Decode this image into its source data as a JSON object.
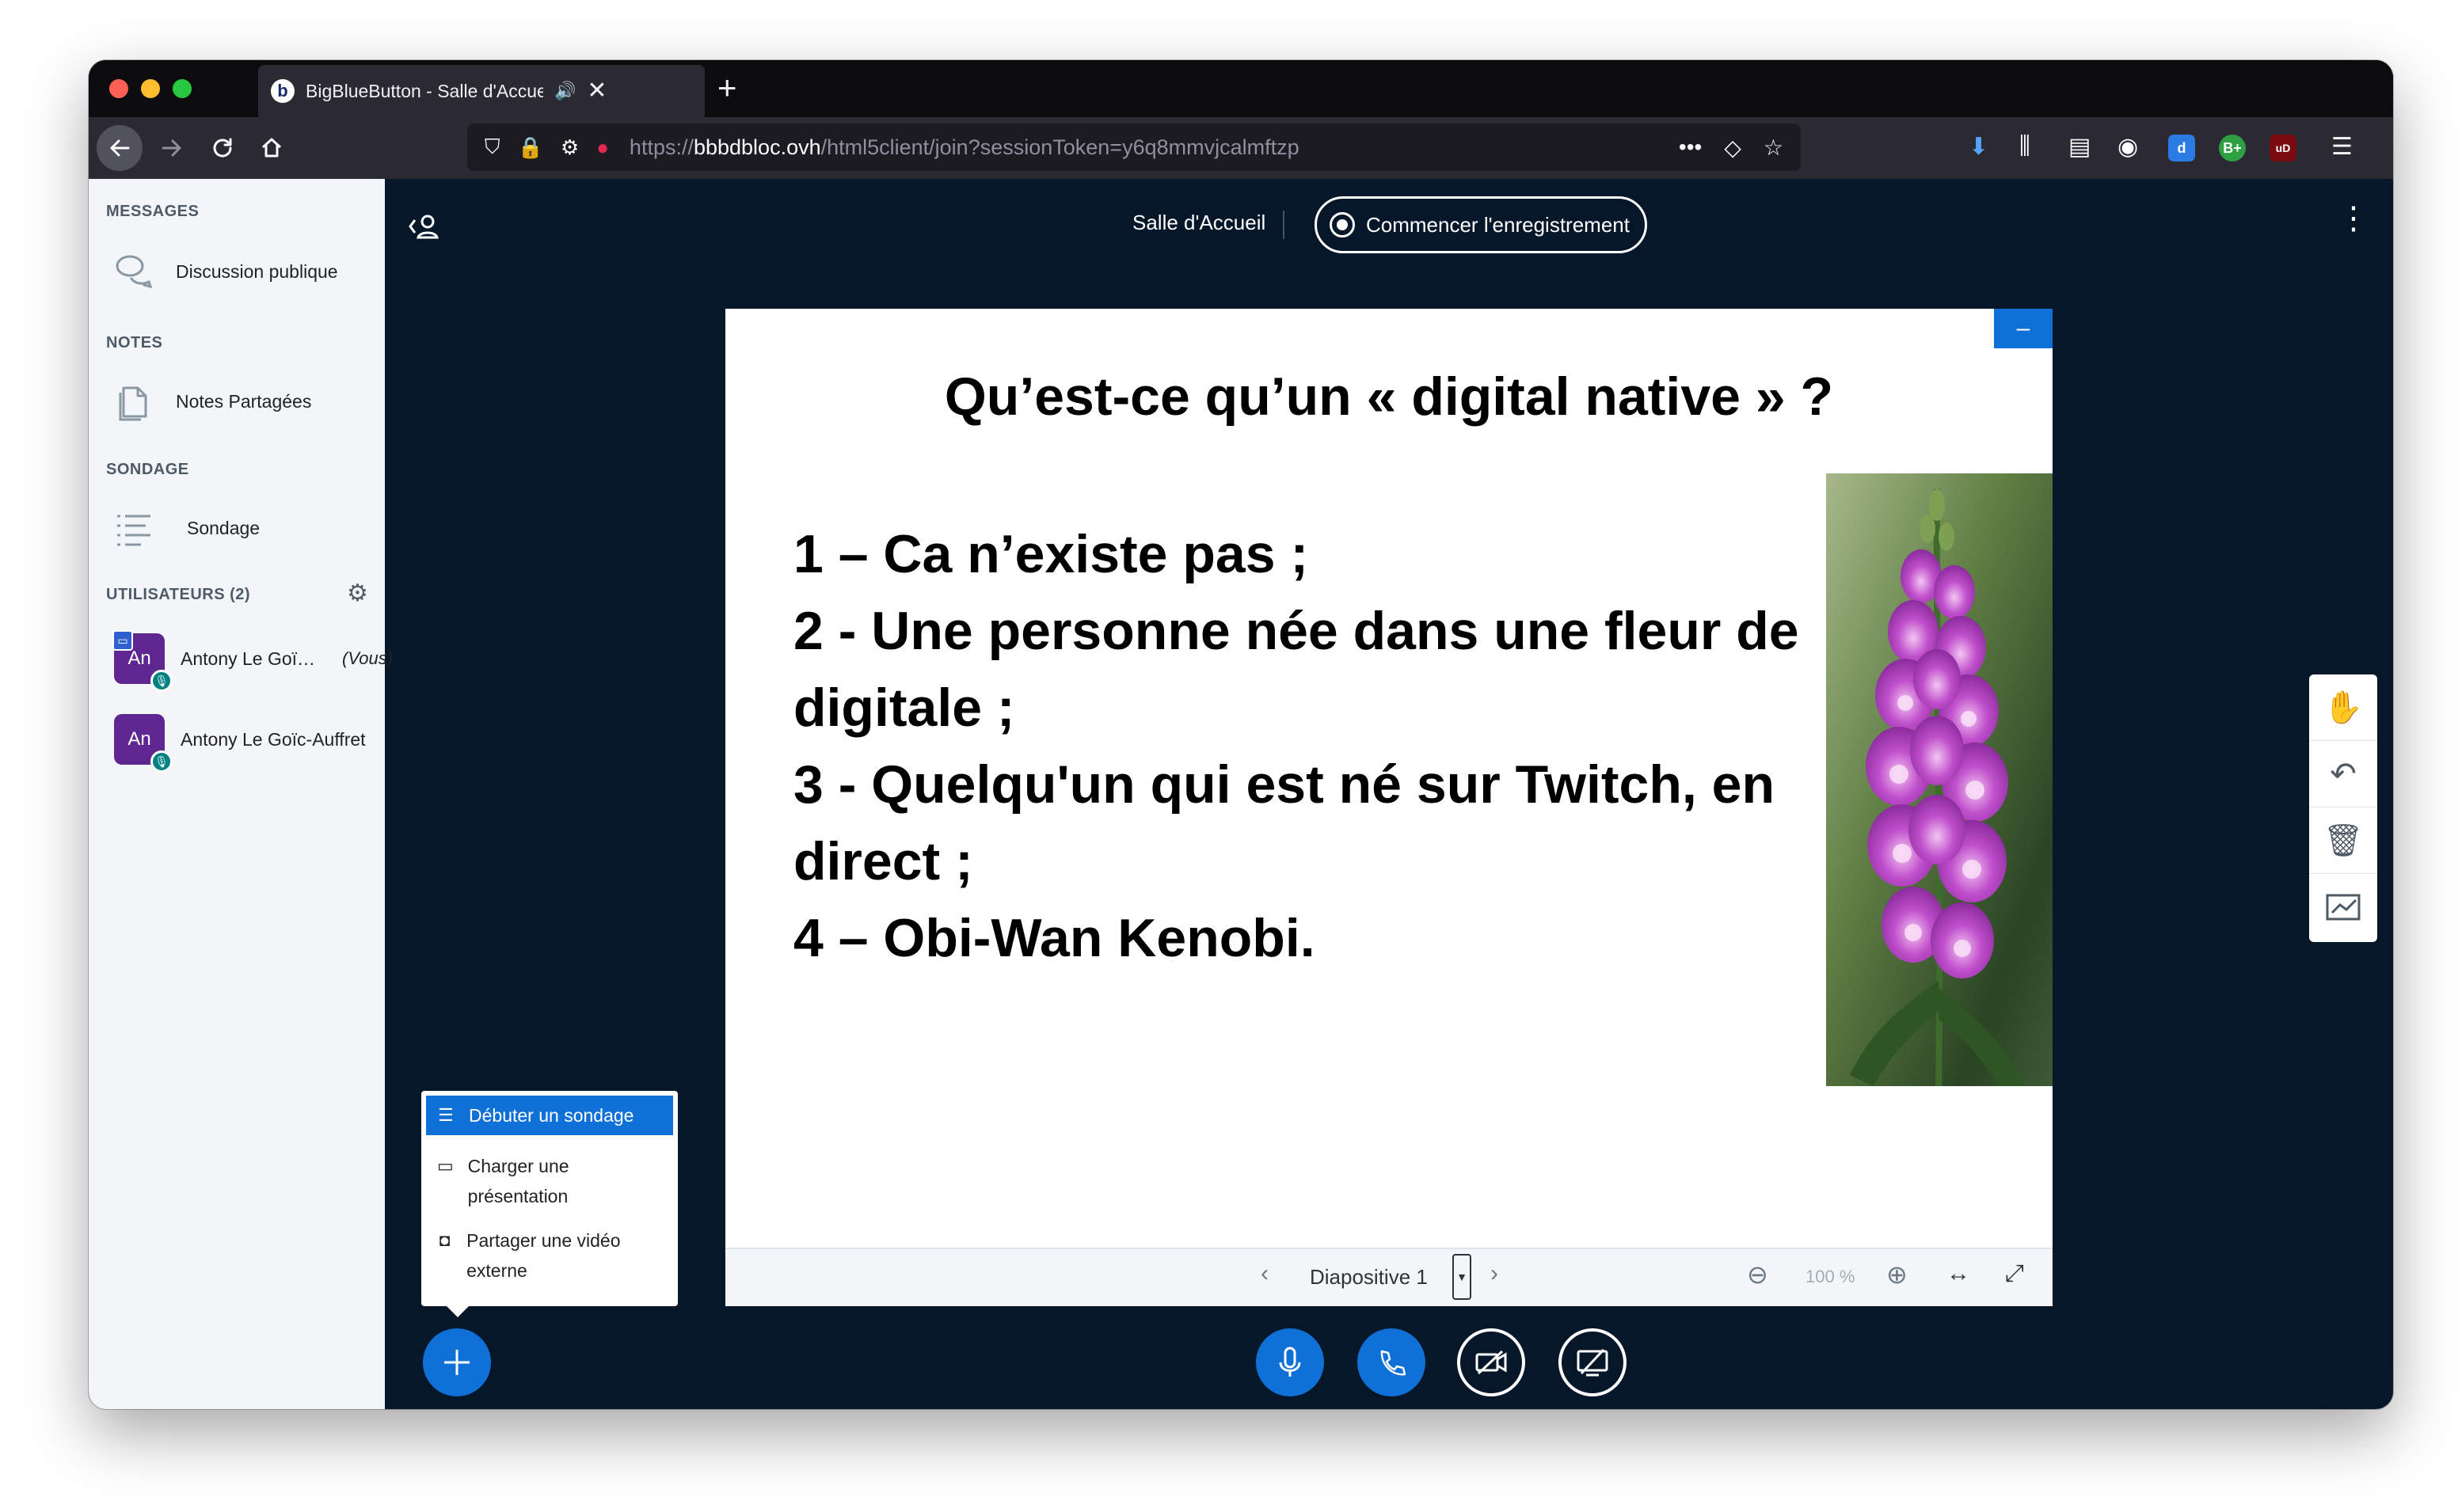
{
  "browser": {
    "tab_title": "BigBlueButton - Salle d'Accueil",
    "tab_favicon": "b",
    "tab_audio_icon": "speaker-icon",
    "tab_close": "✕",
    "new_tab": "+",
    "url_scheme": "https://",
    "url_host": "bbbdbloc.ovh",
    "url_path": "/html5client/join?sessionToken=y6q8mmvjcalmftzp",
    "url_more": "•••"
  },
  "sidebar": {
    "messages_header": "MESSAGES",
    "public_chat": "Discussion publique",
    "notes_header": "NOTES",
    "shared_notes": "Notes Partagées",
    "poll_header": "SONDAGE",
    "poll": "Sondage",
    "users_header": "UTILISATEURS (2)",
    "users": [
      {
        "initials": "An",
        "name": "Antony Le Goï…",
        "you": "(Vous)"
      },
      {
        "initials": "An",
        "name": "Antony Le Goïc-Auffret"
      }
    ]
  },
  "meeting": {
    "title": "Salle d'Accueil",
    "record_label": "Commencer l'enregistrement"
  },
  "slide": {
    "title": "Qu’est-ce qu’un « digital native » ?",
    "lines": [
      "1 – Ca n’existe pas ;",
      "2 - Une personne née dans une fleur de",
      "digitale ;",
      "3 - Quelqu'un qui est né sur Twitch, en",
      "direct ;",
      "4 – Obi-Wan Kenobi."
    ],
    "minimize": "–",
    "image_subject": "foxglove-flower-image"
  },
  "slide_toolbar": {
    "slide_label": "Diapositive 1",
    "zoom": "100 %"
  },
  "actions_menu": {
    "items": [
      {
        "label": "Débuter un sondage",
        "icon": "poll-icon"
      },
      {
        "label": "Charger une présentation",
        "icon": "presentation-icon"
      },
      {
        "label": "Partager une vidéo externe",
        "icon": "video-icon"
      }
    ]
  },
  "colors": {
    "accent": "#0f70d7",
    "background": "#06172a",
    "avatar": "#5e2790"
  }
}
